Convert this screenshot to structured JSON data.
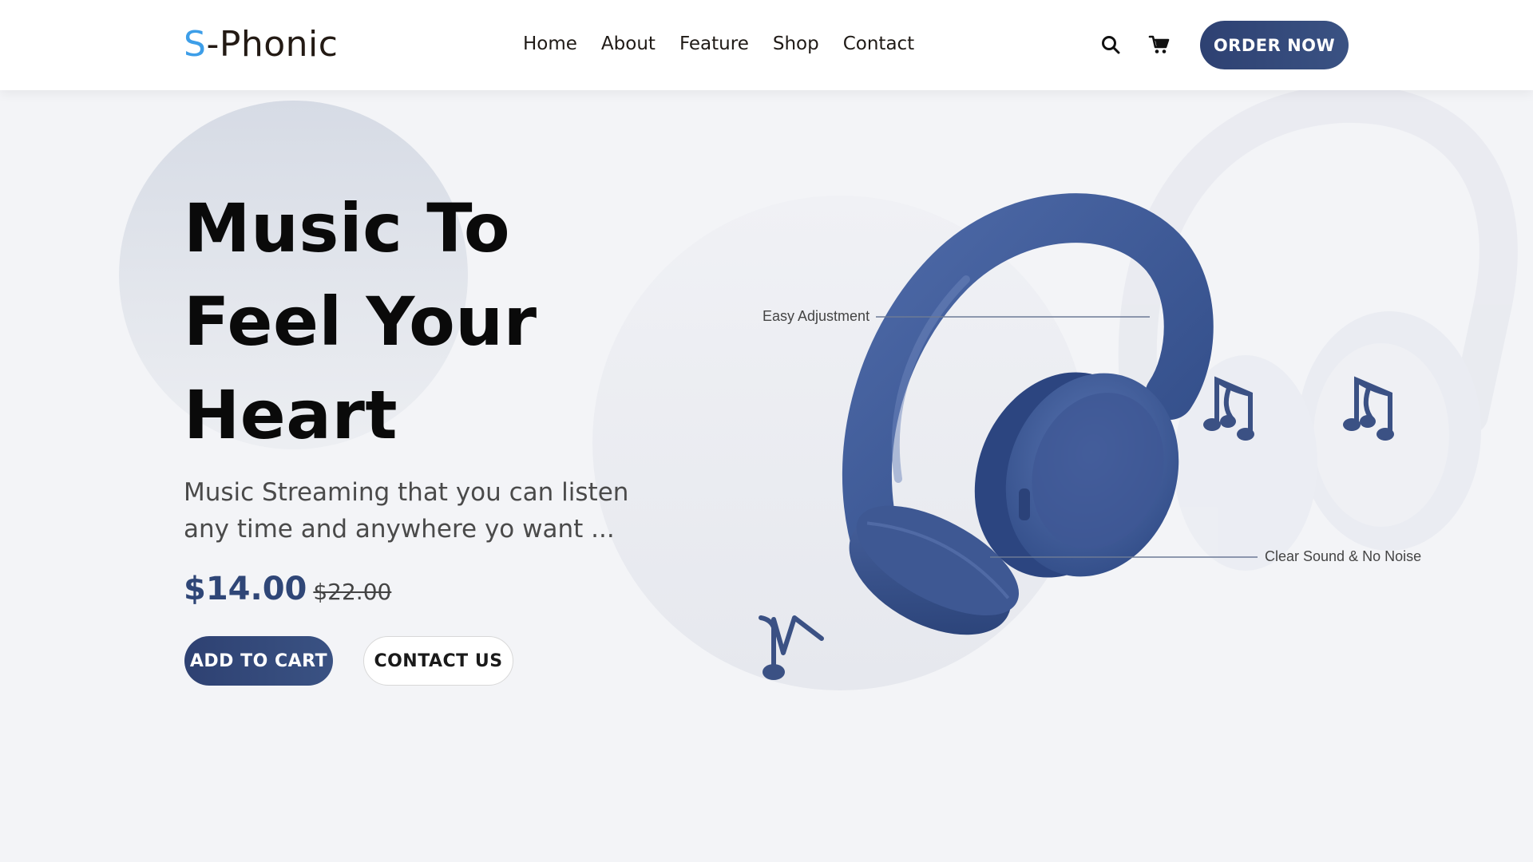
{
  "header": {
    "logo_accent": "S",
    "logo_rest": "-Phonic",
    "nav": [
      "Home",
      "About",
      "Feature",
      "Shop",
      "Contact"
    ],
    "order_label": "ORDER NOW",
    "icons": [
      "search-icon",
      "cart-icon"
    ]
  },
  "hero": {
    "title_lines": [
      "Music To",
      "Feel Your",
      "Heart"
    ],
    "subtitle": "Music Streaming that you can listen any time and anywhere yo want ...",
    "price_now": "$14.00",
    "price_old": "$22.00",
    "add_to_cart_label": "ADD TO CART",
    "contact_label": "CONTACT US"
  },
  "product": {
    "callouts": [
      "Easy Adjustment",
      "Clear Sound & No Noise"
    ],
    "decor_icons": [
      "music-note-icon",
      "music-notes-icon"
    ]
  },
  "colors": {
    "brand_navy": "#2e4172",
    "logo_accent": "#3d9ee8",
    "headphone_blue": "#3a5690",
    "background": "#f3f4f7"
  }
}
